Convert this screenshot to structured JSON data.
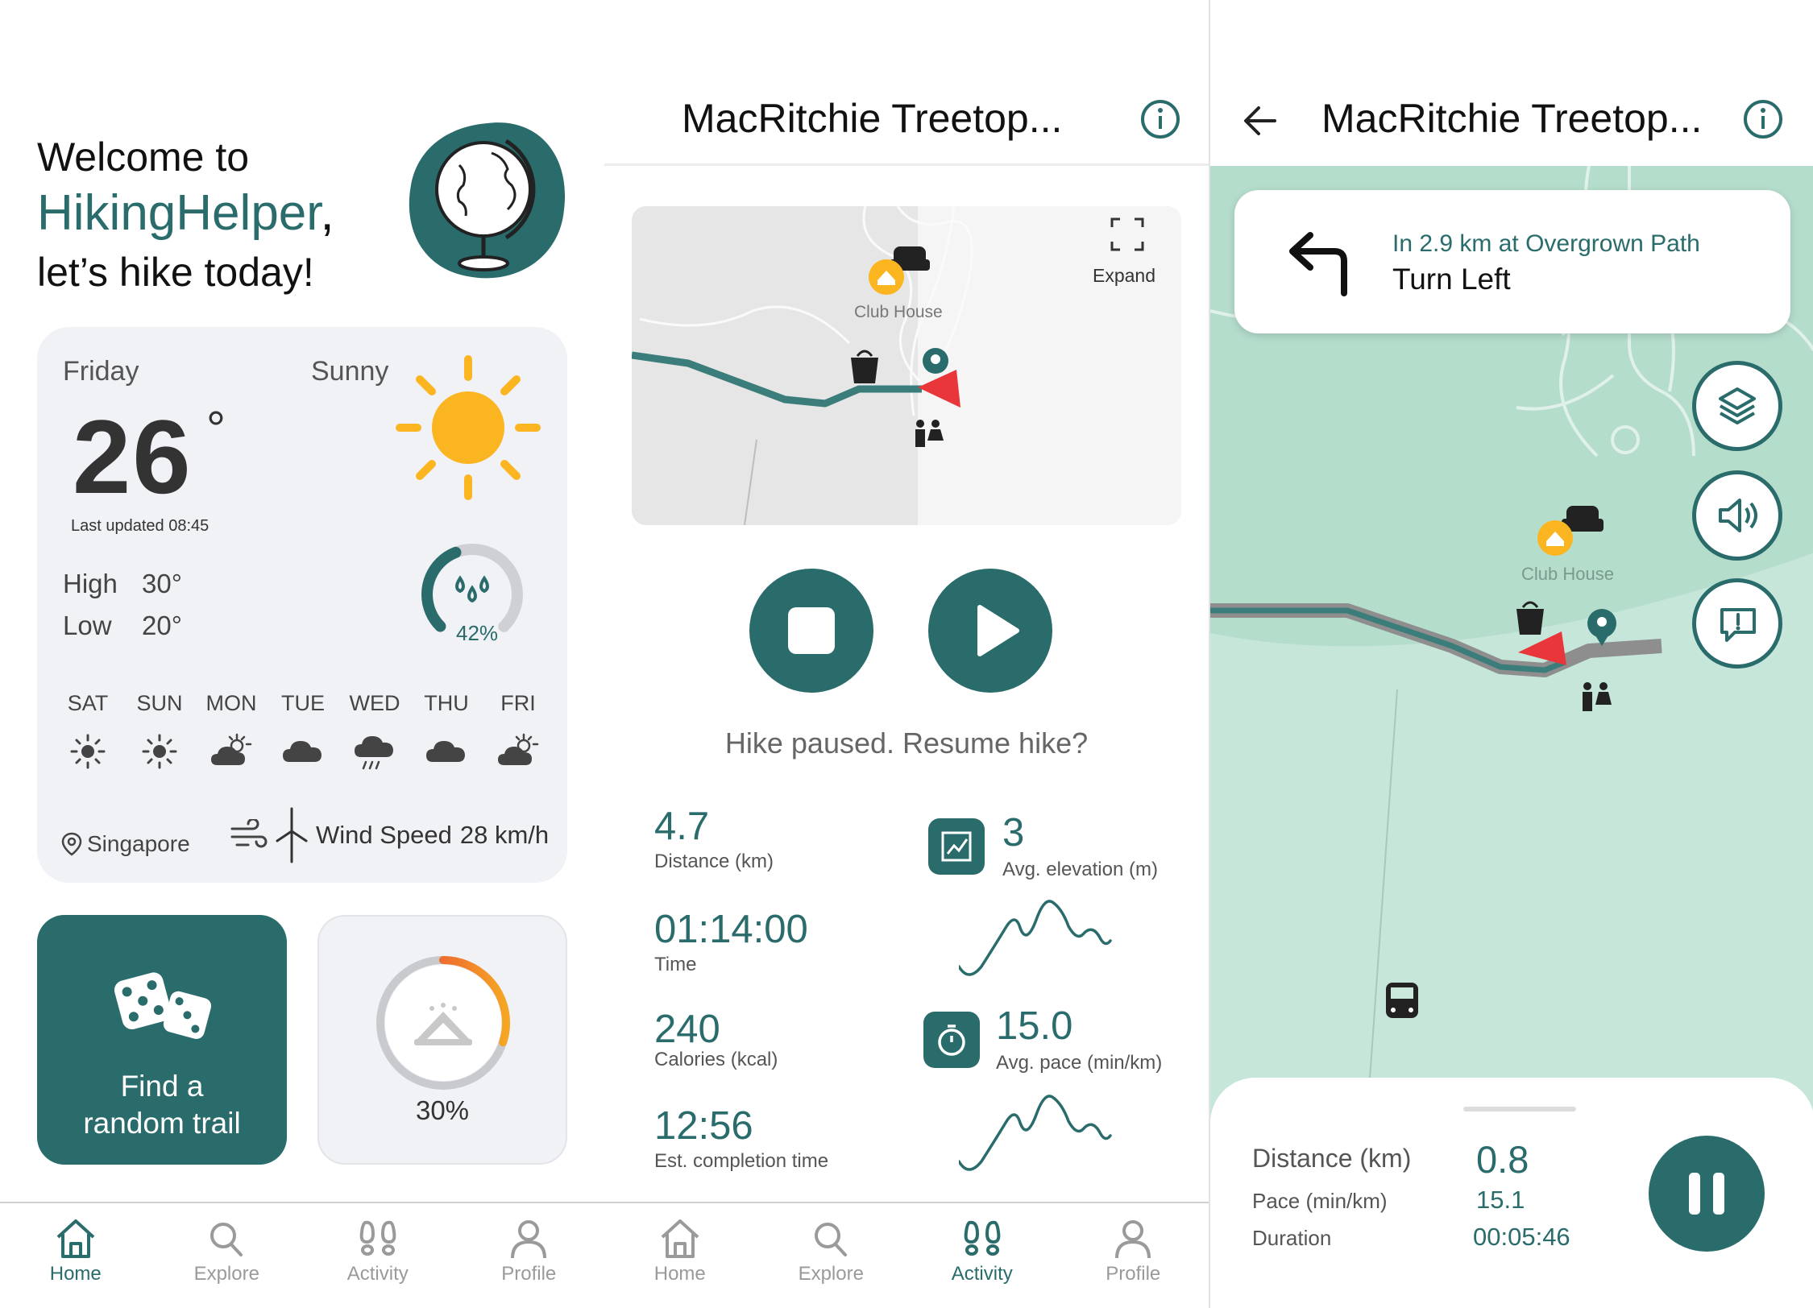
{
  "home": {
    "welcome_line1": "Welcome to",
    "brand": "HikingHelper",
    "brand_comma": ",",
    "welcome_line3": "let’s hike today!",
    "weather": {
      "day": "Friday",
      "condition": "Sunny",
      "temperature": "26",
      "degree": "°",
      "last_updated": "Last updated  08:45",
      "high_label": "High",
      "high_value": "30°",
      "low_label": "Low",
      "low_value": "20°",
      "humidity": "42%",
      "humidity_fraction": 0.42,
      "forecast": [
        {
          "day": "SAT",
          "icon": "sun-icon"
        },
        {
          "day": "SUN",
          "icon": "sun-icon"
        },
        {
          "day": "MON",
          "icon": "partly-cloudy-icon"
        },
        {
          "day": "TUE",
          "icon": "cloud-icon"
        },
        {
          "day": "WED",
          "icon": "rain-icon"
        },
        {
          "day": "THU",
          "icon": "cloud-icon"
        },
        {
          "day": "FRI",
          "icon": "partly-cloudy-icon"
        }
      ],
      "location": "Singapore",
      "wind_label": "Wind Speed",
      "wind_value": "28 km/h"
    },
    "random_trail_label_1": "Find a",
    "random_trail_label_2": "random trail",
    "progress_label": "30%",
    "progress_fraction": 0.3
  },
  "nav": {
    "home": "Home",
    "explore": "Explore",
    "activity": "Activity",
    "profile": "Profile"
  },
  "activity": {
    "title": "MacRitchie Treetop...",
    "map_expand": "Expand",
    "map_poi": "Club House",
    "resume_prompt": "Hike paused. Resume hike?",
    "distance_value": "4.7",
    "distance_label": "Distance (km)",
    "time_value": "01:14:00",
    "time_label": "Time",
    "calories_value": "240",
    "calories_label": "Calories (kcal)",
    "completion_value": "12:56",
    "completion_label": "Est. completion time",
    "elevation_value": "3",
    "elevation_label": "Avg. elevation (m)",
    "pace_value": "15.0",
    "pace_label": "Avg. pace (min/km)"
  },
  "navigation": {
    "title": "MacRitchie Treetop...",
    "turn_distance": "In 2.9 km at Overgrown Path",
    "turn_instruction": "Turn Left",
    "map_poi": "Club House",
    "distance_label": "Distance (km)",
    "distance_value": "0.8",
    "pace_label": "Pace (min/km)",
    "pace_value": "15.1",
    "duration_label": "Duration",
    "duration_value": "00:05:46"
  },
  "colors": {
    "primary": "#2a6b6b",
    "sun": "#fbb521",
    "alert": "#e8363b",
    "map_green": "#c2e4d7"
  }
}
